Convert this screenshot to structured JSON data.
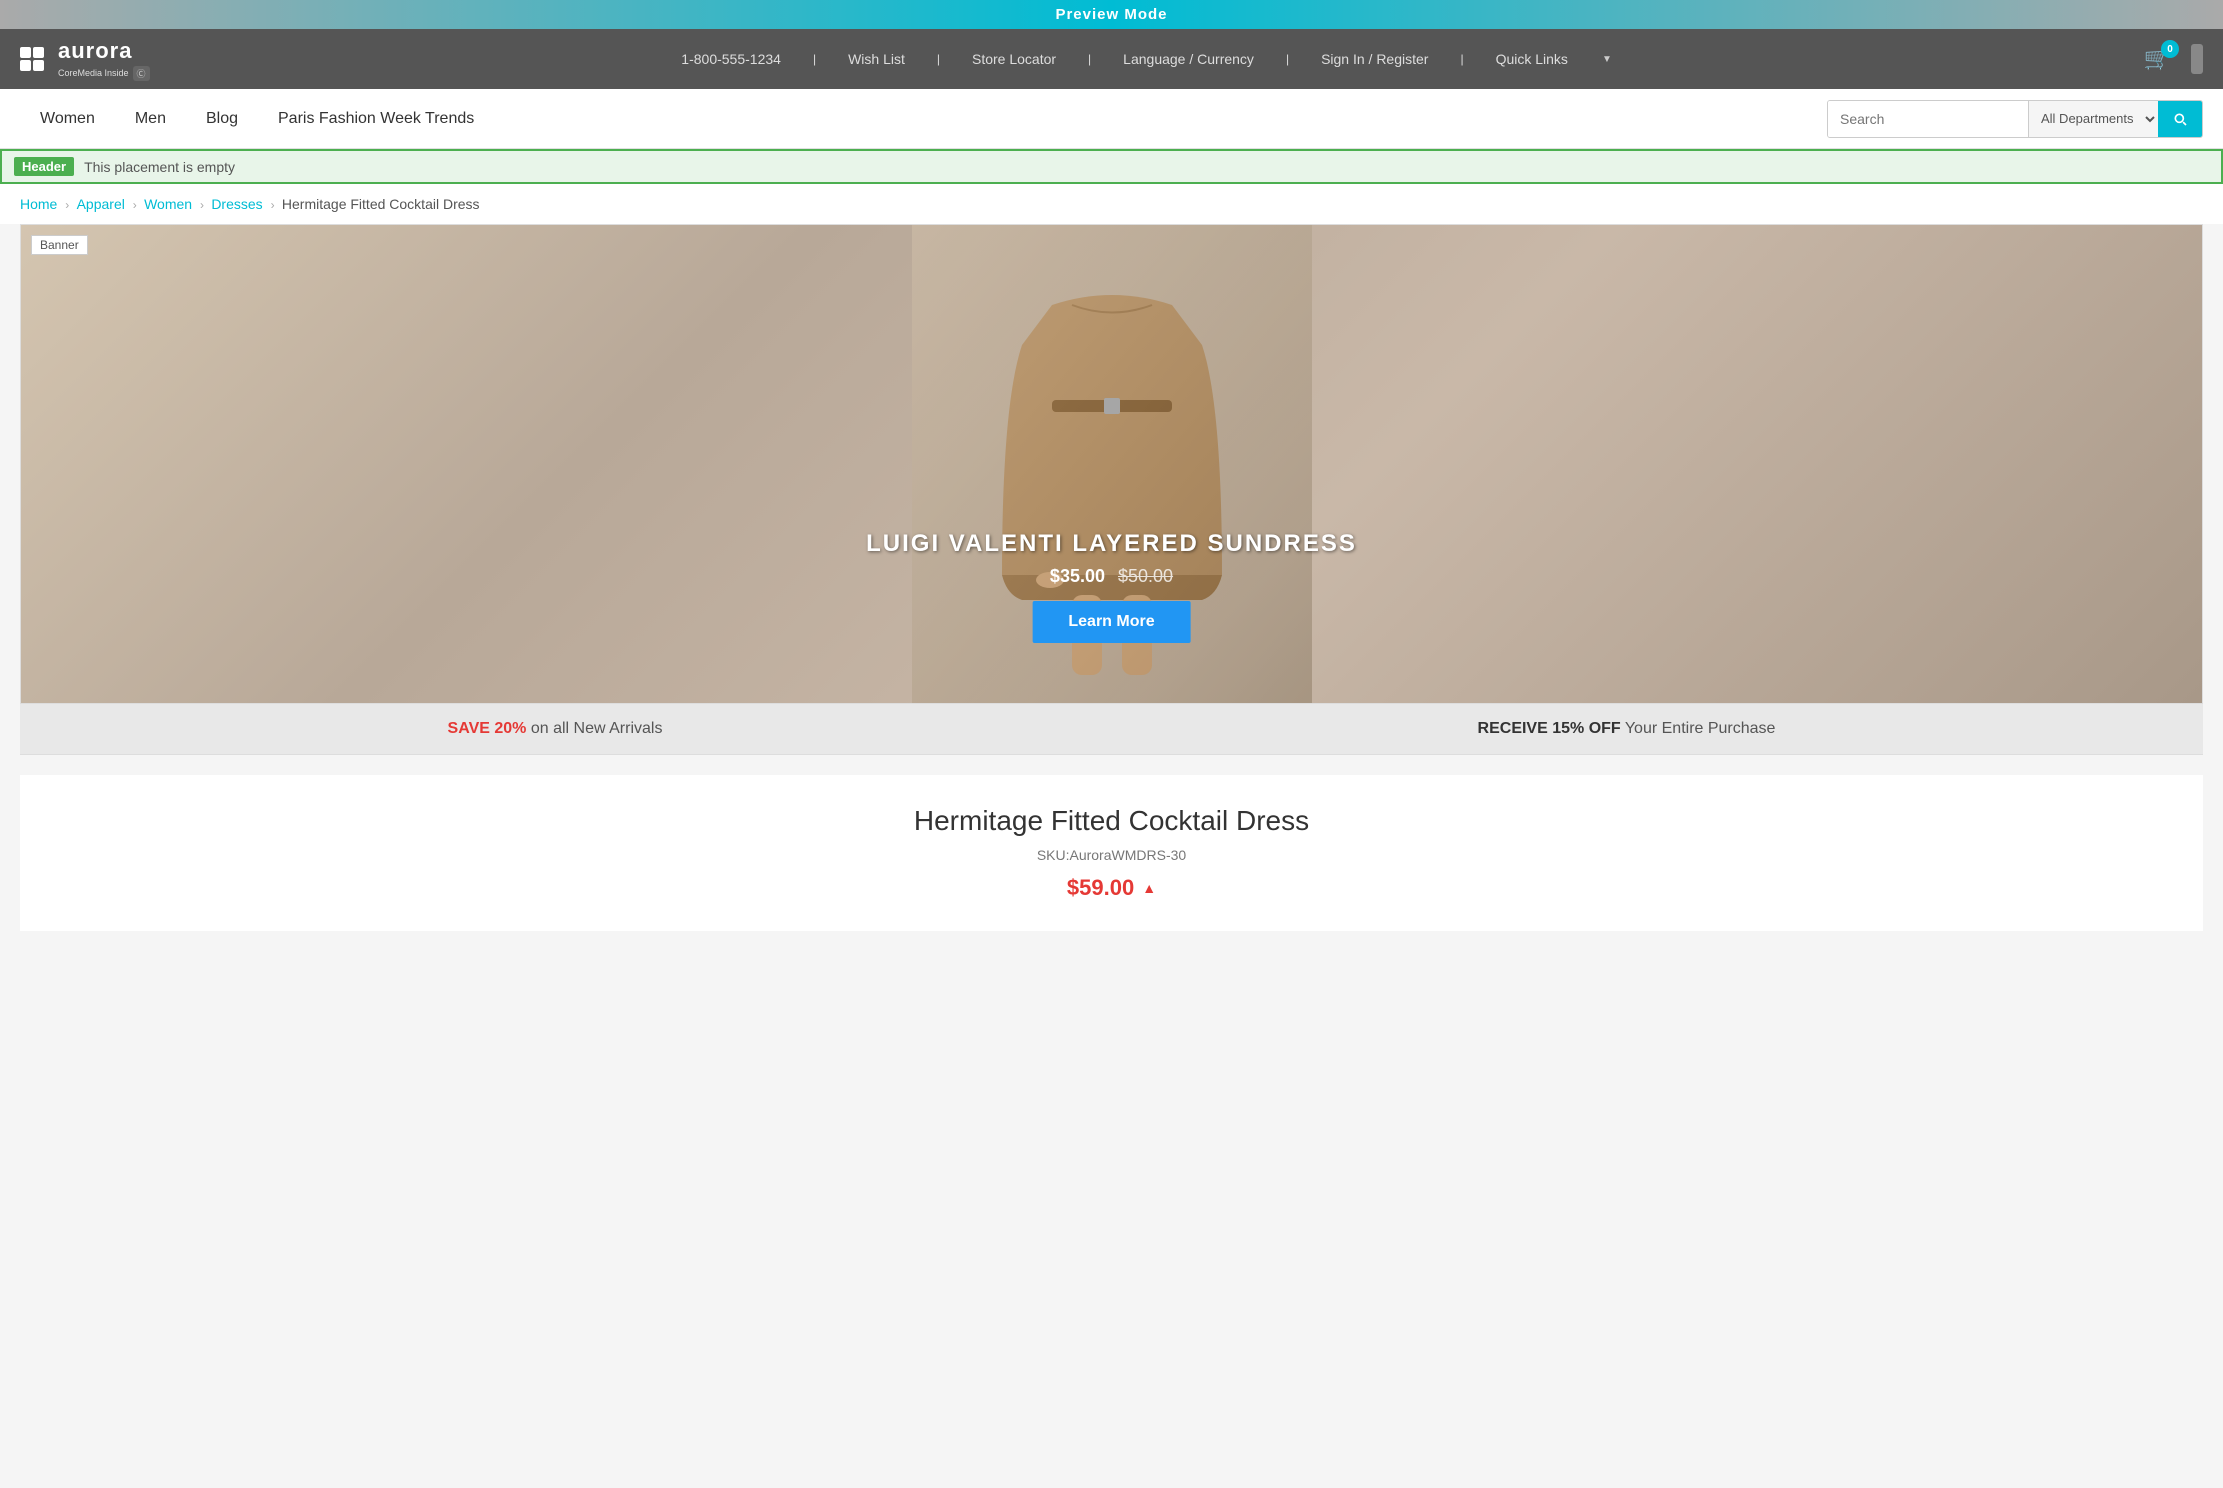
{
  "preview": {
    "bar_text": "Preview Mode"
  },
  "top_header": {
    "phone": "1-800-555-1234",
    "wish_list": "Wish List",
    "store_locator": "Store Locator",
    "language_currency": "Language / Currency",
    "sign_in": "Sign In / Register",
    "quick_links": "Quick Links",
    "cart_count": "0",
    "logo_name": "aurora",
    "logo_subtitle": "CoreMedia Inside"
  },
  "main_nav": {
    "items": [
      {
        "label": "Women"
      },
      {
        "label": "Men"
      },
      {
        "label": "Blog"
      },
      {
        "label": "Paris Fashion Week Trends"
      }
    ],
    "search_placeholder": "Search",
    "dept_default": "All Departments",
    "search_button_label": "Search"
  },
  "header_placement": {
    "label": "Header",
    "text": "This placement is empty"
  },
  "breadcrumb": {
    "items": [
      {
        "label": "Home",
        "href": "#"
      },
      {
        "label": "Apparel",
        "href": "#"
      },
      {
        "label": "Women",
        "href": "#"
      },
      {
        "label": "Dresses",
        "href": "#"
      }
    ],
    "current": "Hermitage Fitted Cocktail Dress"
  },
  "banner": {
    "label": "Banner",
    "title": "LUIGI VALENTI LAYERED SUNDRESS",
    "price_new": "$35.00",
    "price_old": "$50.00",
    "cta_button": "Learn More"
  },
  "promo_strip": {
    "left_highlight": "SAVE 20%",
    "left_text": " on all New Arrivals",
    "right_highlight": "RECEIVE 15% OFF",
    "right_text": " Your Entire Purchase"
  },
  "product": {
    "title": "Hermitage Fitted Cocktail Dress",
    "sku": "SKU:AuroraWMDRS-30",
    "price": "$59.00"
  }
}
